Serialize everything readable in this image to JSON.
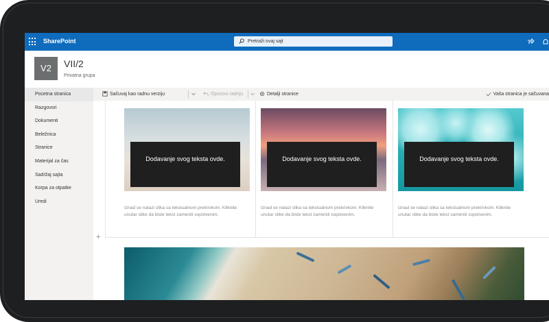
{
  "topbar": {
    "app_name": "SharePoint",
    "search_placeholder": "Pretraži ovaj sajt"
  },
  "site": {
    "logo_text": "V2",
    "title": "VII/2",
    "subtitle": "Privatna grupa"
  },
  "nav": {
    "items": [
      {
        "label": "Pocetna stranica"
      },
      {
        "label": "Razgovori"
      },
      {
        "label": "Dokumenti"
      },
      {
        "label": "Beležnica"
      },
      {
        "label": "Stranice"
      },
      {
        "label": "Materijal za čas"
      },
      {
        "label": "Sadržaj sajta"
      },
      {
        "label": "Korpa za otpatke"
      },
      {
        "label": "Uredi"
      }
    ]
  },
  "commands": {
    "save_draft": "Sačuvaj kao radnu verziju",
    "undo": "Opozovi radnju",
    "details": "Detalji stranice",
    "status": "Vaša stranica je sačuvana"
  },
  "cards": [
    {
      "caption": "Dodavanje svog teksta ovde.",
      "text_line1": "Iznad se nalazi slika sa tekstualnom prekrivkom. Kliknite",
      "text_line2": "unutar slike da biste tekst zamenili sopstvenim."
    },
    {
      "caption": "Dodavanje svog teksta ovde.",
      "text_line1": "Iznad se nalazi slika sa tekstualnom prekrivkom. Kliknite",
      "text_line2": "unutar slike da biste tekst zamenili sopstvenim."
    },
    {
      "caption": "Dodavanje svog teksta ovde.",
      "text_line1": "Iznad se nalazi slika sa tekstualnom prekrivkom. Kliknite",
      "text_line2": "unutar slike da biste tekst zamenili sopstvenim."
    }
  ],
  "colors": {
    "suite_bar": "#0f6cbd",
    "logo_bg": "#6c6f6f",
    "caption_bg": "#1f1f1f"
  },
  "icons": {
    "app_launcher": "waffle-icon",
    "search": "search-icon",
    "share": "share-icon",
    "notifications": "bell-icon",
    "save": "save-icon",
    "undo": "undo-icon",
    "settings": "gear-icon",
    "check": "check-icon"
  }
}
